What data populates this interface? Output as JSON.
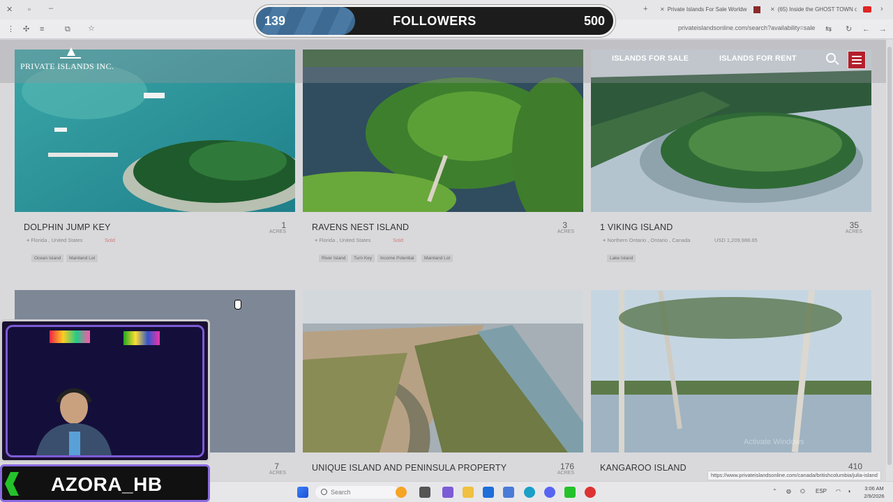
{
  "browser": {
    "tabs": [
      {
        "label": "Private Islands For Sale Worldw",
        "fav_color": "#8b2a2a"
      },
      {
        "label": "(65) Inside the GHOST TOWN o",
        "fav_color": "#e02424"
      }
    ],
    "url": "privateislandsonline.com/search?availability=sale",
    "status_url": "https://www.privateislandsonline.com/canada/britishcolumbia/julia-island"
  },
  "followers": {
    "current": "139",
    "label": "FOLLOWERS",
    "goal": "500",
    "progress": 0.278
  },
  "site": {
    "logo": "PRIVATE ISLANDS INC.",
    "nav": [
      "ISLANDS FOR SALE",
      "ISLANDS FOR RENT"
    ]
  },
  "listings": [
    {
      "title": "DOLPHIN JUMP KEY",
      "size": "1",
      "unit": "ACRES",
      "location": "Florida , United States",
      "status": "Sold",
      "price": "",
      "tags": [
        "Ocean Island",
        "Mainland Lot"
      ]
    },
    {
      "title": "RAVENS NEST ISLAND",
      "size": "3",
      "unit": "ACRES",
      "location": "Florida , United States",
      "status": "Sold",
      "price": "",
      "tags": [
        "River Island",
        "Turn Key",
        "Income Potential",
        "Mainland Lot"
      ]
    },
    {
      "title": "1 VIKING ISLAND",
      "size": "35",
      "unit": "ACRES",
      "location": "Northern Ontario , Ontario , Canada",
      "status": "",
      "price": "USD 1,209,988.65",
      "tags": [
        "Lake Island"
      ]
    },
    {
      "title": "",
      "size": "7",
      "unit": "ACRES"
    },
    {
      "title": "UNIQUE ISLAND AND PENINSULA PROPERTY",
      "size": "176",
      "unit": "ACRES"
    },
    {
      "title": "KANGAROO ISLAND",
      "size": "410",
      "unit": ""
    }
  ],
  "streamer": {
    "name": "AZORA_HB"
  },
  "taskbar": {
    "search_placeholder": "Search",
    "lang": "ESP",
    "time": "3:06 AM",
    "date": "2/9/2026"
  },
  "watermark": "Activate Windows"
}
